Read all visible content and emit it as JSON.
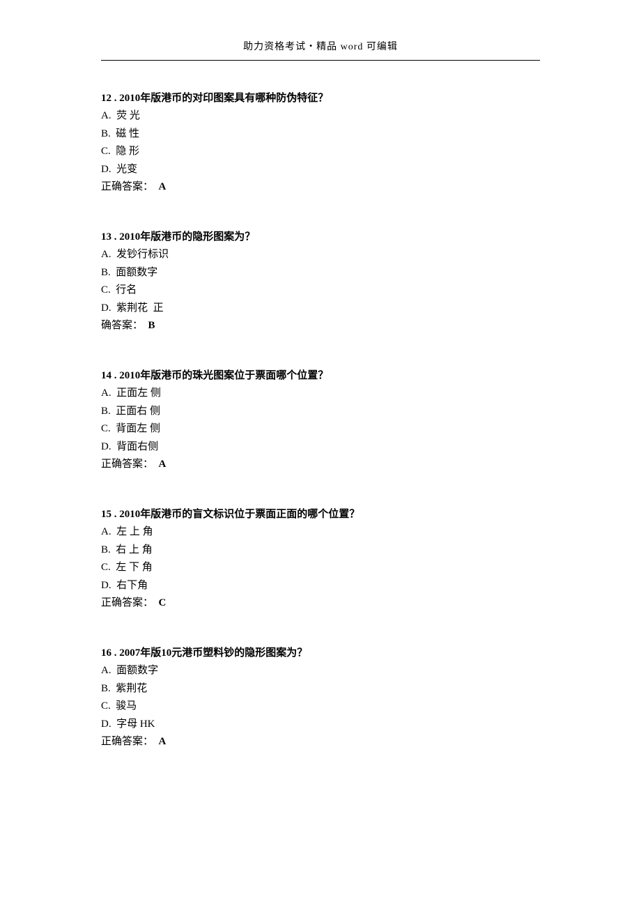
{
  "header": {
    "prefix": "助力资格考试",
    "separator": "・",
    "mid": "精品",
    "wordLabel": " word ",
    "suffix": "可编辑"
  },
  "questions": [
    {
      "number": "12 .",
      "text": " 2010年版港币的对印图案具有哪种防伪特征？",
      "options": [
        "A.  荧 光",
        "B.  磁 性",
        "C.  隐 形",
        "D.  光变"
      ],
      "answerLabel": "正确答案：  ",
      "answerValue": "A"
    },
    {
      "number": "13 .",
      "text": " 2010年版港币的隐形图案为？",
      "options": [
        "A.  发钞行标识",
        "B.  面额数字",
        "C.  行名",
        "D.  紫荆花  正"
      ],
      "answerLabel": "确答案：  ",
      "answerValue": "B"
    },
    {
      "number": "14 .",
      "text": " 2010年版港币的珠光图案位于票面哪个位置？",
      "options": [
        "A.  正面左 侧",
        "B.  正面右 侧",
        "C.  背面左 侧",
        "D.  背面右侧"
      ],
      "answerLabel": "正确答案：  ",
      "answerValue": "A"
    },
    {
      "number": "15 .",
      "text": " 2010年版港币的盲文标识位于票面正面的哪个位置？",
      "options": [
        "A.  左 上 角",
        "B.  右 上 角",
        "C.  左 下 角",
        "D.  右下角"
      ],
      "answerLabel": "正确答案：  ",
      "answerValue": "C"
    },
    {
      "number": "16 .",
      "text": " 2007年版10元港币塑料钞的隐形图案为？",
      "options": [
        "A.  面额数字",
        "B.  紫荆花",
        "C.  骏马",
        "D.  字母 HK"
      ],
      "answerLabel": "正确答案：  ",
      "answerValue": "A"
    }
  ]
}
